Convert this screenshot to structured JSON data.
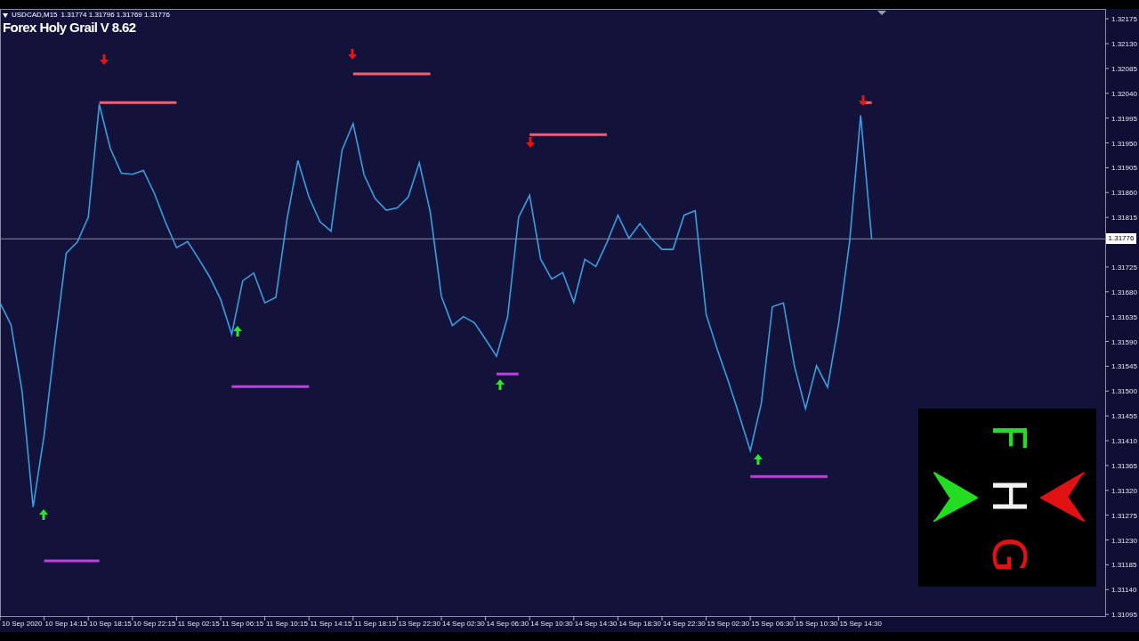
{
  "symbol_bar": {
    "symbol": "USDCAD,M15",
    "ohlc": "1.31774 1.31796 1.31769 1.31776"
  },
  "indicator_title": "Forex Holy Grail V 8.62",
  "chart": {
    "chart_data": {
      "type": "line",
      "categories": [
        null,
        null,
        "10 Sep 2020",
        null,
        null,
        null,
        "10 Sep 14:15",
        null,
        null,
        null,
        "10 Sep 18:15",
        null,
        null,
        null,
        "10 Sep 22:15",
        null,
        null,
        null,
        "11 Sep 02:15",
        null,
        null,
        null,
        "11 Sep 06:15",
        null,
        null,
        null,
        "11 Sep 10:15",
        null,
        null,
        null,
        "11 Sep 14:15",
        null,
        null,
        null,
        "11 Sep 18:15",
        null,
        null,
        null,
        "13 Sep 22:30",
        null,
        null,
        null,
        "14 Sep 02:30",
        null,
        null,
        null,
        "14 Sep 06:30",
        null,
        null,
        null,
        "14 Sep 10:30",
        null,
        null,
        null,
        "14 Sep 14:30",
        null,
        null,
        null,
        "14 Sep 18:30",
        null,
        null,
        null,
        "14 Sep 22:30",
        null,
        null,
        null,
        "15 Sep 02:30",
        null,
        null,
        null,
        "15 Sep 06:30",
        null,
        null,
        null,
        "15 Sep 10:30",
        null,
        null,
        null,
        "15 Sep 14:30",
        null
      ],
      "series": [
        {
          "color": "#3a9ee0",
          "values": [
            1.3166,
            1.3162,
            1.315,
            1.3129,
            1.3142,
            1.3159,
            1.3175,
            1.3177,
            1.31815,
            1.3202,
            1.3194,
            1.31895,
            1.31893,
            1.319,
            1.31858,
            1.31806,
            1.3176,
            1.31771,
            1.3174,
            1.31707,
            1.31666,
            1.31603,
            1.317,
            1.31714,
            1.3166,
            1.3167,
            1.3181,
            1.31918,
            1.31852,
            1.31807,
            1.3179,
            1.31937,
            1.31985,
            1.31892,
            1.31849,
            1.31828,
            1.31832,
            1.31852,
            1.31914,
            1.31824,
            1.31672,
            1.31619,
            1.31635,
            1.31624,
            1.31594,
            1.31563,
            1.31634,
            1.31815,
            1.31855,
            1.31739,
            1.31703,
            1.31715,
            1.31661,
            1.31739,
            1.31726,
            1.31769,
            1.31819,
            1.31777,
            1.31804,
            1.31777,
            1.31757,
            1.31757,
            1.31819,
            1.31827,
            1.31639,
            1.31576,
            1.31518,
            1.31456,
            1.31392,
            1.31478,
            1.31653,
            1.3166,
            1.31545,
            1.31468,
            1.31546,
            1.31507,
            1.31622,
            1.31771,
            1.32,
            1.31776
          ]
        },
        {
          "color": "#f0606e",
          "values": [
            null,
            null,
            null,
            null,
            null,
            null,
            null,
            null,
            null,
            1.32023,
            1.32023,
            1.32023,
            1.32023,
            1.32023,
            1.32023,
            1.32023,
            1.32023,
            null,
            null,
            null,
            null,
            null,
            null,
            null,
            null,
            null,
            null,
            null,
            null,
            null,
            null,
            null,
            null,
            null,
            null,
            null,
            null,
            null,
            null,
            null,
            null,
            null,
            null,
            null,
            null,
            null,
            null,
            null,
            null,
            null,
            null,
            null,
            null,
            null,
            null,
            null,
            null,
            null,
            null,
            null,
            null,
            null,
            null,
            null,
            null,
            null,
            null,
            null,
            null,
            null,
            null,
            null,
            null,
            null,
            null,
            null,
            null,
            null,
            null,
            null
          ]
        },
        {
          "color": "#f0606e",
          "values": [
            null,
            null,
            null,
            null,
            null,
            null,
            null,
            null,
            null,
            null,
            null,
            null,
            null,
            null,
            null,
            null,
            null,
            null,
            null,
            null,
            null,
            null,
            null,
            null,
            null,
            null,
            null,
            null,
            null,
            null,
            null,
            null,
            1.32075,
            1.32075,
            1.32075,
            1.32075,
            1.32075,
            1.32075,
            1.32075,
            1.32075,
            null,
            null,
            null,
            null,
            null,
            null,
            null,
            null,
            null,
            null,
            null,
            null,
            null,
            null,
            null,
            null,
            null,
            null,
            null,
            null,
            null,
            null,
            null,
            null,
            null,
            null,
            null,
            null,
            null,
            null,
            null,
            null,
            null,
            null,
            null,
            null,
            null,
            null,
            null,
            null
          ]
        },
        {
          "color": "#f0606e",
          "values": [
            null,
            null,
            null,
            null,
            null,
            null,
            null,
            null,
            null,
            null,
            null,
            null,
            null,
            null,
            null,
            null,
            null,
            null,
            null,
            null,
            null,
            null,
            null,
            null,
            null,
            null,
            null,
            null,
            null,
            null,
            null,
            null,
            null,
            null,
            null,
            null,
            null,
            null,
            null,
            null,
            null,
            null,
            null,
            null,
            null,
            null,
            null,
            null,
            1.31965,
            1.31965,
            1.31965,
            1.31965,
            1.31965,
            1.31965,
            1.31965,
            1.31965,
            null,
            null,
            null,
            null,
            null,
            null,
            null,
            null,
            null,
            null,
            null,
            null,
            null,
            null,
            null,
            null,
            null,
            null,
            null,
            null,
            null,
            null,
            null,
            null
          ]
        },
        {
          "color": "#f0606e",
          "values": [
            null,
            null,
            null,
            null,
            null,
            null,
            null,
            null,
            null,
            null,
            null,
            null,
            null,
            null,
            null,
            null,
            null,
            null,
            null,
            null,
            null,
            null,
            null,
            null,
            null,
            null,
            null,
            null,
            null,
            null,
            null,
            null,
            null,
            null,
            null,
            null,
            null,
            null,
            null,
            null,
            null,
            null,
            null,
            null,
            null,
            null,
            null,
            null,
            null,
            null,
            null,
            null,
            null,
            null,
            null,
            null,
            null,
            null,
            null,
            null,
            null,
            null,
            null,
            null,
            null,
            null,
            null,
            null,
            null,
            null,
            null,
            null,
            null,
            null,
            null,
            null,
            null,
            null,
            1.32023,
            1.32023
          ]
        },
        {
          "color": "#c23ee0",
          "values": [
            null,
            null,
            null,
            null,
            1.31192,
            1.31192,
            1.31192,
            1.31192,
            1.31192,
            1.31192,
            null,
            null,
            null,
            null,
            null,
            null,
            null,
            null,
            null,
            null,
            null,
            null,
            null,
            null,
            null,
            null,
            null,
            null,
            null,
            null,
            null,
            null,
            null,
            null,
            null,
            null,
            null,
            null,
            null,
            null,
            null,
            null,
            null,
            null,
            null,
            null,
            null,
            null,
            null,
            null,
            null,
            null,
            null,
            null,
            null,
            null,
            null,
            null,
            null,
            null,
            null,
            null,
            null,
            null,
            null,
            null,
            null,
            null,
            null,
            null,
            null,
            null,
            null,
            null,
            null,
            null,
            null,
            null,
            null,
            null
          ]
        },
        {
          "color": "#c23ee0",
          "values": [
            null,
            null,
            null,
            null,
            null,
            null,
            null,
            null,
            null,
            null,
            null,
            null,
            null,
            null,
            null,
            null,
            null,
            null,
            null,
            null,
            null,
            1.31508,
            1.31508,
            1.31508,
            1.31508,
            1.31508,
            1.31508,
            1.31508,
            1.31508,
            null,
            null,
            null,
            null,
            null,
            null,
            null,
            null,
            null,
            null,
            null,
            null,
            null,
            null,
            null,
            null,
            null,
            null,
            null,
            null,
            null,
            null,
            null,
            null,
            null,
            null,
            null,
            null,
            null,
            null,
            null,
            null,
            null,
            null,
            null,
            null,
            null,
            null,
            null,
            null,
            null,
            null,
            null,
            null,
            null,
            null,
            null,
            null,
            null,
            null,
            null
          ]
        },
        {
          "color": "#c23ee0",
          "values": [
            null,
            null,
            null,
            null,
            null,
            null,
            null,
            null,
            null,
            null,
            null,
            null,
            null,
            null,
            null,
            null,
            null,
            null,
            null,
            null,
            null,
            null,
            null,
            null,
            null,
            null,
            null,
            null,
            null,
            null,
            null,
            null,
            null,
            null,
            null,
            null,
            null,
            null,
            null,
            null,
            null,
            null,
            null,
            null,
            null,
            1.31531,
            1.31531,
            1.31531,
            null,
            null,
            null,
            null,
            null,
            null,
            null,
            null,
            null,
            null,
            null,
            null,
            null,
            null,
            null,
            null,
            null,
            null,
            null,
            null,
            null,
            null,
            null,
            null,
            null,
            null,
            null,
            null,
            null,
            null,
            null,
            null
          ]
        },
        {
          "color": "#c23ee0",
          "values": [
            null,
            null,
            null,
            null,
            null,
            null,
            null,
            null,
            null,
            null,
            null,
            null,
            null,
            null,
            null,
            null,
            null,
            null,
            null,
            null,
            null,
            null,
            null,
            null,
            null,
            null,
            null,
            null,
            null,
            null,
            null,
            null,
            null,
            null,
            null,
            null,
            null,
            null,
            null,
            null,
            null,
            null,
            null,
            null,
            null,
            null,
            null,
            null,
            null,
            null,
            null,
            null,
            null,
            null,
            null,
            null,
            null,
            null,
            null,
            null,
            null,
            null,
            null,
            null,
            null,
            null,
            null,
            null,
            1.31345,
            1.31345,
            1.31345,
            1.31345,
            1.31345,
            1.31345,
            1.31345,
            1.31345,
            null,
            null,
            null,
            null
          ]
        }
      ],
      "ylim": [
        1.31092,
        1.32193
      ],
      "yticks": [
        {
          "value": 1.32175,
          "label": "1.32175"
        },
        {
          "value": 1.3213,
          "label": "1.32130"
        },
        {
          "value": 1.32085,
          "label": "1.32085"
        },
        {
          "value": 1.3204,
          "label": "1.32040"
        },
        {
          "value": 1.31995,
          "label": "1.31995"
        },
        {
          "value": 1.3195,
          "label": "1.31950"
        },
        {
          "value": 1.31905,
          "label": "1.31905"
        },
        {
          "value": 1.3186,
          "label": "1.31860"
        },
        {
          "value": 1.31815,
          "label": "1.31815"
        },
        {
          "value": 1.31725,
          "label": "1.31725"
        },
        {
          "value": 1.3168,
          "label": "1.31680"
        },
        {
          "value": 1.31635,
          "label": "1.31635"
        },
        {
          "value": 1.3159,
          "label": "1.31590"
        },
        {
          "value": 1.31545,
          "label": "1.31545"
        },
        {
          "value": 1.315,
          "label": "1.31500"
        },
        {
          "value": 1.31455,
          "label": "1.31455"
        },
        {
          "value": 1.3141,
          "label": "1.31410"
        },
        {
          "value": 1.31365,
          "label": "1.31365"
        },
        {
          "value": 1.3132,
          "label": "1.31320"
        },
        {
          "value": 1.31275,
          "label": "1.31275"
        },
        {
          "value": 1.3123,
          "label": "1.31230"
        },
        {
          "value": 1.31185,
          "label": "1.31185"
        },
        {
          "value": 1.3114,
          "label": "1.31140"
        },
        {
          "value": 1.31095,
          "label": "1.31095"
        }
      ],
      "ref_lines": [
        {
          "axis": "y",
          "value": 1.31776,
          "label": "1.31776",
          "color": "#8c8ca4"
        }
      ]
    },
    "signals": [
      {
        "kind": "sell",
        "color": "#ee1111"
      },
      {
        "kind": "sell",
        "color": "#ee1111"
      },
      {
        "kind": "sell",
        "color": "#ee1111"
      },
      {
        "kind": "sell",
        "color": "#ee1111"
      },
      {
        "kind": "buy",
        "color": "#22ee22"
      },
      {
        "kind": "buy",
        "color": "#22ee22"
      },
      {
        "kind": "buy",
        "color": "#22ee22"
      },
      {
        "kind": "buy",
        "color": "#22ee22"
      }
    ]
  },
  "logo": {
    "letters": [
      {
        "text": "F",
        "color": "#22dd22"
      },
      {
        "text": "H",
        "color": "#f2f2f2"
      },
      {
        "text": "G",
        "color": "#e01212"
      }
    ]
  }
}
